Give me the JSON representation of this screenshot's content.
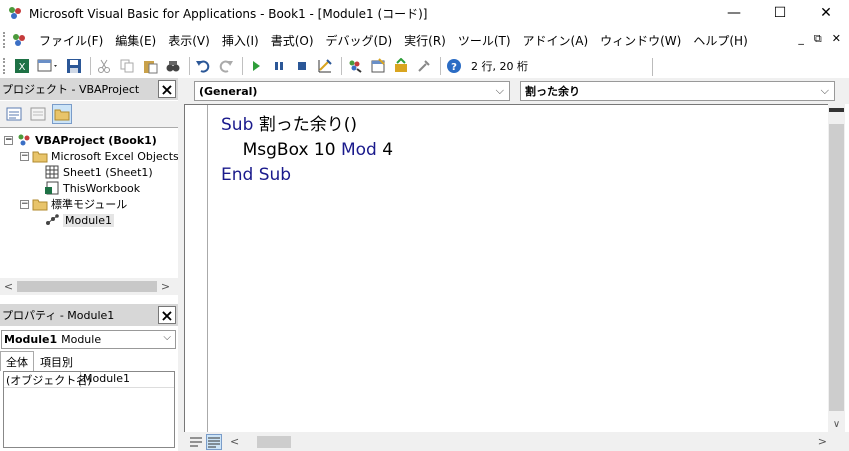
{
  "window": {
    "title": "Microsoft Visual Basic for Applications - Book1 - [Module1 (コード)]",
    "minimize_glyph": "—",
    "maximize_glyph": "☐",
    "close_glyph": "✕"
  },
  "menu": {
    "items": [
      "ファイル(F)",
      "編集(E)",
      "表示(V)",
      "挿入(I)",
      "書式(O)",
      "デバッグ(D)",
      "実行(R)",
      "ツール(T)",
      "アドイン(A)",
      "ウィンドウ(W)",
      "ヘルプ(H)"
    ],
    "mdi_minimize": "_",
    "mdi_restore": "⧉",
    "mdi_close": "✕"
  },
  "toolbar": {
    "position_text": "2 行, 20 桁"
  },
  "project_panel": {
    "title": "プロジェクト - VBAProject",
    "tree": [
      {
        "label": "VBAProject (Book1)",
        "bold": true
      },
      {
        "label": "Microsoft Excel Objects"
      },
      {
        "label": "Sheet1 (Sheet1)"
      },
      {
        "label": "ThisWorkbook"
      },
      {
        "label": "標準モジュール"
      },
      {
        "label": "Module1"
      }
    ]
  },
  "properties_panel": {
    "title": "プロパティ - Module1",
    "object_name": "Module1",
    "object_type": "Module",
    "tabs": [
      "全体",
      "項目別"
    ],
    "rows": [
      {
        "key": "(オブジェクト名)",
        "value": "Module1"
      }
    ]
  },
  "code_window": {
    "object_combo": "(General)",
    "procedure_combo": "割った余り",
    "lines": [
      [
        {
          "t": "Sub",
          "kw": true
        },
        {
          "t": " 割った余り()",
          "kw": false
        }
      ],
      [
        {
          "t": "    MsgBox 10 ",
          "kw": false
        },
        {
          "t": "Mod",
          "kw": true
        },
        {
          "t": " 4",
          "kw": false
        }
      ],
      [
        {
          "t": "End Sub",
          "kw": true
        }
      ]
    ]
  },
  "colors": {
    "keyword": "#1a1a8c",
    "panel_header": "#d7d7d7",
    "chrome": "#f0f0f0"
  }
}
